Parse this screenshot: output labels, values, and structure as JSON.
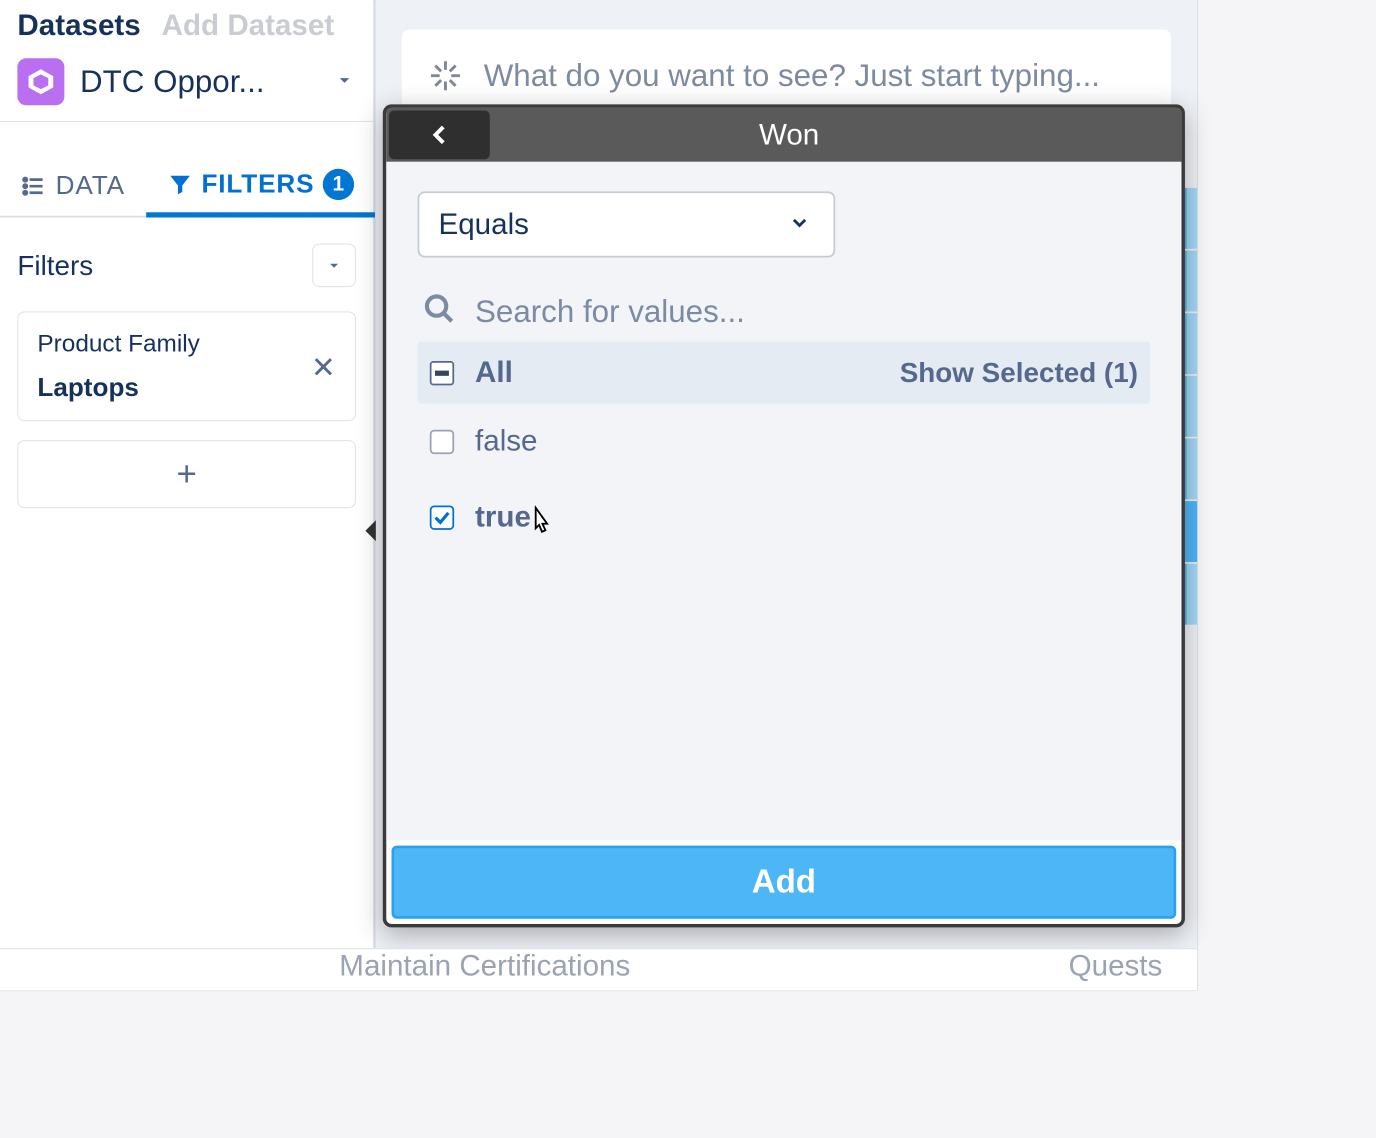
{
  "sidebar": {
    "datasets_label": "Datasets",
    "add_dataset_label": "Add Dataset",
    "selected_dataset": "DTC Oppor...",
    "tabs": {
      "data_label": "DATA",
      "filters_label": "FILTERS",
      "filters_count": "1"
    },
    "filters_section_title": "Filters",
    "filter_card": {
      "field": "Product Family",
      "value": "Laptops"
    },
    "add_filter_label": "+"
  },
  "query_input": {
    "placeholder": "What do you want to see? Just start typing..."
  },
  "filter_panel": {
    "title": "Won",
    "operator": "Equals",
    "search_placeholder": "Search for values...",
    "all_label": "All",
    "show_selected_label": "Show Selected (1)",
    "values": [
      {
        "label": "false",
        "checked": false
      },
      {
        "label": "true",
        "checked": true
      }
    ],
    "add_button_label": "Add"
  },
  "bottom": {
    "left": "Maintain Certifications",
    "right": "Quests"
  }
}
